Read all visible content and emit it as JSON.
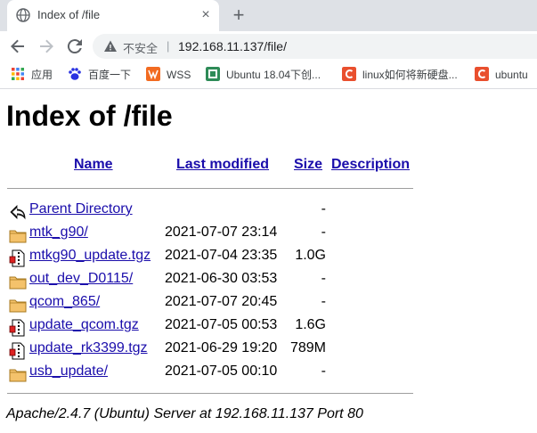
{
  "tab": {
    "title": "Index of /file",
    "favicon": "globe-icon",
    "close": "×"
  },
  "new_tab": "+",
  "omnibox": {
    "security_label": "不安全",
    "separator": "|",
    "url": "192.168.11.137/file/"
  },
  "bookmarks": [
    {
      "label": "应用",
      "icon": "apps-icon",
      "color": "#4285f4"
    },
    {
      "label": "百度一下",
      "icon": "baidu-icon",
      "color": "#2932e1"
    },
    {
      "label": "WSS",
      "icon": "wss-icon",
      "color": "#f26b21"
    },
    {
      "label": "Ubuntu 18.04下创...",
      "icon": "ubuntu-bookmark-icon",
      "color": "#2e8b57"
    },
    {
      "label": "linux如何将新硬盘...",
      "icon": "csdn-icon",
      "color": "#e94f2e"
    },
    {
      "label": "ubuntu",
      "icon": "csdn-icon",
      "color": "#e94f2e"
    }
  ],
  "page": {
    "title": "Index of /file",
    "columns": {
      "name": "Name",
      "last_modified": "Last modified",
      "size": "Size",
      "description": "Description"
    },
    "rows": [
      {
        "name": "Parent Directory",
        "date": "",
        "size": "-",
        "icon": "back-arrow-icon"
      },
      {
        "name": "mtk_g90/",
        "date": "2021-07-07 23:14",
        "size": "-",
        "icon": "folder-icon"
      },
      {
        "name": "mtkg90_update.tgz",
        "date": "2021-07-04 23:35",
        "size": "1.0G",
        "icon": "compressed-file-icon"
      },
      {
        "name": "out_dev_D0115/",
        "date": "2021-06-30 03:53",
        "size": "-",
        "icon": "folder-icon"
      },
      {
        "name": "qcom_865/",
        "date": "2021-07-07 20:45",
        "size": "-",
        "icon": "folder-icon"
      },
      {
        "name": "update_qcom.tgz",
        "date": "2021-07-05 00:53",
        "size": "1.6G",
        "icon": "compressed-file-icon"
      },
      {
        "name": "update_rk3399.tgz",
        "date": "2021-06-29 19:20",
        "size": "789M",
        "icon": "compressed-file-icon"
      },
      {
        "name": "usb_update/",
        "date": "2021-07-05 00:10",
        "size": "-",
        "icon": "folder-icon"
      }
    ],
    "footer": "Apache/2.4.7 (Ubuntu) Server at 192.168.11.137 Port 80"
  }
}
